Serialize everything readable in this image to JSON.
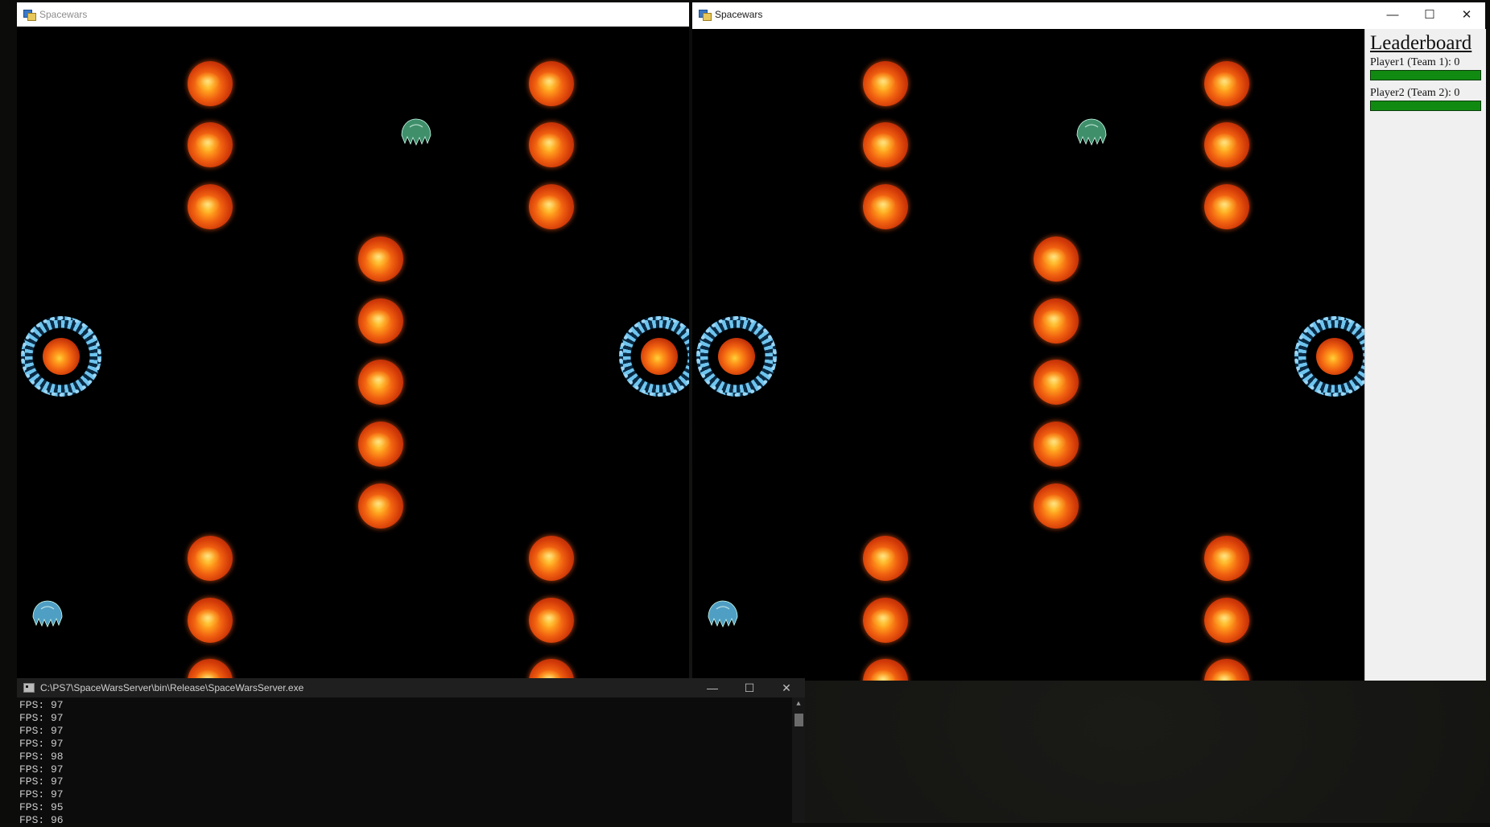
{
  "left_window": {
    "title": "Spacewars"
  },
  "right_window": {
    "title": "Spacewars",
    "controls": {
      "minimize": "—",
      "maximize": "☐",
      "close": "✕"
    }
  },
  "leaderboard": {
    "title": "Leaderboard",
    "players": [
      {
        "label": "Player1 (Team 1): 0",
        "health": 1.0
      },
      {
        "label": "Player2 (Team 2): 0",
        "health": 1.0
      }
    ]
  },
  "console": {
    "title": "C:\\PS7\\SpaceWarsServer\\bin\\Release\\SpaceWarsServer.exe",
    "controls": {
      "minimize": "—",
      "maximize": "☐",
      "close": "✕"
    },
    "lines": [
      "FPS: 97",
      "FPS: 97",
      "FPS: 97",
      "FPS: 97",
      "FPS: 98",
      "FPS: 97",
      "FPS: 97",
      "FPS: 97",
      "FPS: 95",
      "FPS: 96"
    ]
  },
  "colors": {
    "sun": "#e8560e",
    "star_base_ring": "#6ec4ee",
    "ship_team1": "#3f8f6b",
    "ship_team2": "#4f9ec4",
    "health_bar": "#118a11"
  },
  "icons": {
    "app": "spacewars-app-icon",
    "console": "console-app-icon",
    "ship1": "green-spaceship-icon",
    "ship2": "blue-spaceship-icon"
  }
}
